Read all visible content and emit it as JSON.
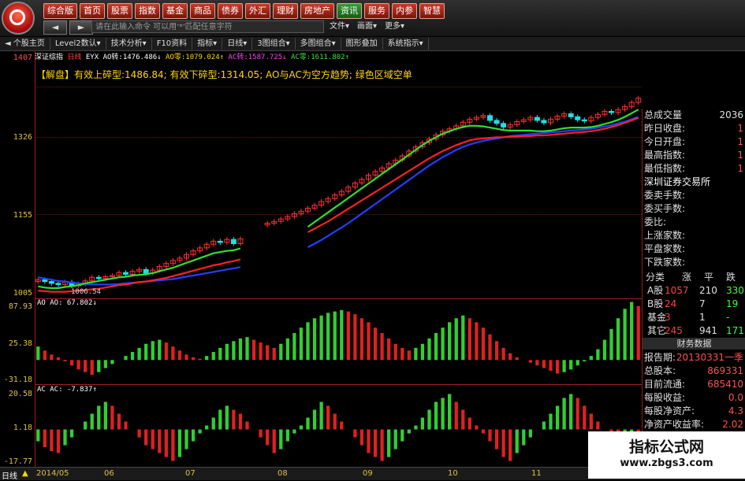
{
  "topmenu": [
    "综合版",
    "首页",
    "股票",
    "指数",
    "基金",
    "商品",
    "债券",
    "外汇",
    "理财",
    "房地产",
    "资讯",
    "服务",
    "内参",
    "智慧"
  ],
  "topmenu_active": "资讯",
  "nav": {
    "back": "◄",
    "forward": "►",
    "cmd_placeholder": "请在此输入命令  可以用'*'匹配任意字符"
  },
  "rightmenu": [
    "文件▾",
    "画面▾",
    "更多▾"
  ],
  "toolbar2": [
    "◄ 个股主页",
    "Level2数认▾",
    "技术分析▾",
    "F10资料",
    "指标▾",
    "日线▾",
    "3图组合▾",
    "多图组合▾",
    "图形叠加",
    "系统指示▾"
  ],
  "infoline": {
    "name": "深证综指",
    "period": "日线",
    "indicator": "EYX",
    "ao_turn_label": "AO转:",
    "ao_turn": "1476.486↓",
    "ao_zero_label": "AO零:",
    "ao_zero": "1079.024↑",
    "ac_turn_label": "AC转:",
    "ac_turn": "1587.725↓",
    "ac_zero_label": "AC零:",
    "ac_zero": "1611.802↑"
  },
  "verdict": "【解盘】有效上碎型:1486.84; 有效下碎型:1314.05; AO与AC为空方趋势; 绿色区域空单",
  "yaxis": {
    "main": [
      "1407",
      "1326",
      "1155",
      "1005"
    ],
    "ao": [
      "87.93",
      "25.38",
      "-31.18"
    ],
    "ac": [
      "20.58",
      "1.18",
      "-17.77"
    ]
  },
  "low_marker": "1006.54",
  "panels": {
    "ao_label": "AO AO: 67.802↓",
    "ac_label": "AC AC: -7.837↑"
  },
  "right_panel": {
    "quote_rows": [
      {
        "label": "总成交量",
        "value": "2036"
      },
      {
        "label": "昨日收盘:",
        "value": "1"
      },
      {
        "label": "今日开盘:",
        "value": "1"
      },
      {
        "label": "最高指数:",
        "value": "1"
      },
      {
        "label": "最低指数:",
        "value": "1"
      }
    ],
    "exchange": "深圳证券交易所",
    "exch_rows": [
      "委卖手数:",
      "委买手数:",
      "委比:",
      "上涨家数:",
      "平盘家数:",
      "下跌家数:"
    ],
    "cat_header": [
      "分类",
      "涨",
      "平",
      "跌"
    ],
    "cats": [
      {
        "name": "A股",
        "up": "1057",
        "flat": "210",
        "down": "330"
      },
      {
        "name": "B股",
        "up": "24",
        "flat": "7",
        "down": "19"
      },
      {
        "name": "基金",
        "up": "3",
        "flat": "1",
        "down": "-"
      },
      {
        "name": "其它",
        "up": "245",
        "flat": "941",
        "down": "171"
      }
    ],
    "finance_title": "财务数据",
    "fin_rows": [
      {
        "label": "报告期:",
        "value": "20130331一季"
      },
      {
        "label": "总股本:",
        "value": "869331"
      },
      {
        "label": "目前流通:",
        "value": "685410"
      },
      {
        "label": "每股收益:",
        "value": "0.0"
      },
      {
        "label": "每股净资产:",
        "value": "4.3"
      },
      {
        "label": "净资产收益率:",
        "value": "2.02"
      }
    ]
  },
  "bottom": {
    "period_label": "日线",
    "dates": [
      "2014/05",
      "06",
      "07",
      "08",
      "09",
      "10",
      "11"
    ]
  },
  "watermark": {
    "line1": "指标公式网",
    "line2": "www.zbgs3.com"
  },
  "colors": {
    "up": "#ff3030",
    "down": "#20e0e0",
    "green_line": "#30e030",
    "red_line": "#ff2020",
    "blue_line": "#2040ff",
    "label": "#e0c040",
    "border": "#9a1a1a"
  },
  "chart_data": {
    "type": "candlestick",
    "ylim": [
      1005,
      1407
    ],
    "close": [
      1036,
      1033,
      1030,
      1028,
      1032,
      1026,
      1029,
      1034,
      1040,
      1038,
      1041,
      1043,
      1048,
      1045,
      1050,
      1053,
      1047,
      1052,
      1058,
      1063,
      1068,
      1072,
      1078,
      1084,
      1089,
      1095,
      1100,
      1098,
      1103,
      1096,
      1104,
      null,
      null,
      null,
      1130,
      1133,
      1137,
      1141,
      1146,
      1150,
      1155,
      1160,
      1166,
      1171,
      1177,
      1183,
      1190,
      1197,
      1203,
      1210,
      1216,
      1222,
      1229,
      1235,
      1242,
      1250,
      1257,
      1264,
      1270,
      1277,
      1283,
      1287,
      1292,
      1298,
      1303,
      1306,
      1309,
      1301,
      1296,
      1290,
      1294,
      1299,
      1302,
      1306,
      1301,
      1297,
      1303,
      1308,
      1312,
      1307,
      1302,
      1300,
      1306,
      1311,
      1316,
      1314,
      1319,
      1324,
      1331,
      1338
    ],
    "green": [
      1025,
      1023,
      1022,
      1022,
      1024,
      1025,
      1027,
      1030,
      1032,
      1034,
      1036,
      1038,
      1040,
      1041,
      1043,
      1044,
      1045,
      1047,
      1050,
      1053,
      1056,
      1060,
      1064,
      1068,
      1072,
      1076,
      1080,
      1082,
      1084,
      1085,
      1088,
      null,
      null,
      null,
      null,
      null,
      null,
      null,
      null,
      null,
      1124,
      1132,
      1140,
      1148,
      1156,
      1164,
      1172,
      1180,
      1188,
      1196,
      1204,
      1212,
      1220,
      1228,
      1236,
      1244,
      1252,
      1260,
      1267,
      1273,
      1279,
      1283,
      1287,
      1290,
      1292,
      1292,
      1291,
      1289,
      1287,
      1285,
      1284,
      1284,
      1284,
      1284,
      1283,
      1283,
      1284,
      1286,
      1288,
      1289,
      1289,
      1289,
      1290,
      1292,
      1295,
      1298,
      1302,
      1307,
      1313,
      1319
    ],
    "red": [
      1018,
      1017,
      1016,
      1016,
      1016,
      1017,
      1018,
      1019,
      1020,
      1021,
      1023,
      1025,
      1027,
      1028,
      1030,
      1032,
      1033,
      1035,
      1037,
      1039,
      1042,
      1045,
      1048,
      1051,
      1054,
      1057,
      1060,
      1062,
      1065,
      1067,
      1070,
      null,
      null,
      null,
      null,
      null,
      null,
      null,
      null,
      null,
      1115,
      1121,
      1127,
      1133,
      1140,
      1147,
      1154,
      1161,
      1168,
      1175,
      1182,
      1189,
      1196,
      1203,
      1210,
      1217,
      1224,
      1231,
      1238,
      1244,
      1250,
      1255,
      1260,
      1264,
      1268,
      1270,
      1271,
      1272,
      1273,
      1273,
      1274,
      1274,
      1275,
      1275,
      1276,
      1276,
      1277,
      1278,
      1279,
      1280,
      1281,
      1282,
      1283,
      1285,
      1287,
      1290,
      1293,
      1297,
      1301,
      1305
    ],
    "blue": [
      1040,
      1038,
      1036,
      1034,
      1033,
      1031,
      1030,
      1029,
      1028,
      1028,
      1028,
      1028,
      1029,
      1030,
      1031,
      1032,
      1033,
      1034,
      1035,
      1036,
      1037,
      1039,
      1041,
      1043,
      1045,
      1047,
      1049,
      1051,
      1053,
      1055,
      1057,
      null,
      null,
      null,
      null,
      null,
      null,
      null,
      null,
      null,
      1090,
      1096,
      1102,
      1109,
      1116,
      1123,
      1130,
      1138,
      1146,
      1154,
      1162,
      1170,
      1178,
      1186,
      1194,
      1202,
      1210,
      1218,
      1226,
      1233,
      1240,
      1246,
      1252,
      1257,
      1261,
      1264,
      1267,
      1269,
      1271,
      1273,
      1275,
      1276,
      1277,
      1278,
      1279,
      1280,
      1281,
      1282,
      1283,
      1284,
      1285,
      1286,
      1287,
      1289,
      1291,
      1293,
      1296,
      1299,
      1303,
      1307
    ],
    "ao": [
      20,
      14,
      8,
      4,
      -2,
      -8,
      -14,
      -18,
      -22,
      -18,
      -12,
      -6,
      0,
      6,
      12,
      18,
      24,
      28,
      30,
      26,
      20,
      14,
      8,
      4,
      2,
      6,
      12,
      18,
      24,
      28,
      32,
      34,
      30,
      26,
      22,
      18,
      24,
      32,
      40,
      48,
      56,
      62,
      66,
      70,
      72,
      74,
      72,
      68,
      62,
      56,
      48,
      40,
      32,
      24,
      18,
      14,
      18,
      24,
      32,
      40,
      48,
      56,
      62,
      66,
      62,
      56,
      48,
      38,
      28,
      18,
      10,
      4,
      0,
      -4,
      -8,
      -12,
      -16,
      -20,
      -18,
      -14,
      -8,
      -2,
      6,
      16,
      30,
      46,
      62,
      76,
      86,
      80
    ],
    "ac": [
      -6,
      -9,
      -11,
      -12,
      -8,
      -4,
      0,
      4,
      8,
      12,
      14,
      12,
      8,
      4,
      0,
      -4,
      -8,
      -10,
      -12,
      -14,
      -16,
      -14,
      -10,
      -6,
      -2,
      2,
      6,
      10,
      12,
      10,
      8,
      4,
      0,
      -4,
      -8,
      -12,
      -10,
      -6,
      -2,
      2,
      6,
      10,
      14,
      12,
      8,
      4,
      0,
      -4,
      -8,
      -12,
      -14,
      -16,
      -14,
      -10,
      -6,
      -2,
      2,
      6,
      10,
      14,
      16,
      18,
      14,
      10,
      6,
      2,
      -2,
      -6,
      -10,
      -14,
      -16,
      -12,
      -8,
      -4,
      0,
      4,
      8,
      12,
      16,
      18,
      16,
      12,
      8,
      4,
      0,
      -4,
      -8,
      -6,
      -4,
      -7.8
    ],
    "ao_ylim": [
      -31.18,
      87.93
    ],
    "ac_ylim": [
      -17.77,
      20.58
    ]
  }
}
